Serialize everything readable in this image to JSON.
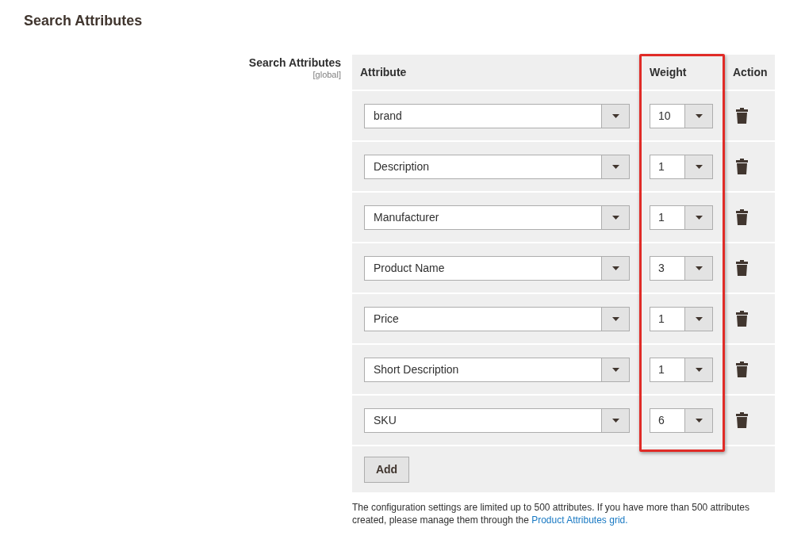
{
  "page_title": "Search Attributes",
  "field": {
    "label": "Search Attributes",
    "scope": "[global]"
  },
  "table": {
    "columns": [
      "Attribute",
      "Weight",
      "Action"
    ],
    "weight_highlighted": true,
    "rows": [
      {
        "attribute": "brand",
        "weight": "10"
      },
      {
        "attribute": "Description",
        "weight": "1"
      },
      {
        "attribute": "Manufacturer",
        "weight": "1"
      },
      {
        "attribute": "Product Name",
        "weight": "3"
      },
      {
        "attribute": "Price",
        "weight": "1"
      },
      {
        "attribute": "Short Description",
        "weight": "1"
      },
      {
        "attribute": "SKU",
        "weight": "6"
      }
    ],
    "add_button": "Add"
  },
  "note": {
    "text": "The configuration settings are limited up to 500 attributes. If you have more than 500 attributes created, please manage them through the ",
    "link": "Product Attributes grid."
  }
}
